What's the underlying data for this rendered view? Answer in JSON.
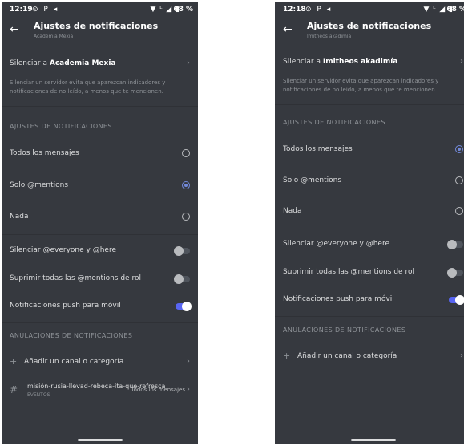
{
  "left": {
    "status": {
      "time": "12:19",
      "left_icons": "⊙ P ◂",
      "right_icons": "▼ ᴸ ◢ ▮",
      "battery": "68 %"
    },
    "header": {
      "title": "Ajustes de notificaciones",
      "subtitle": "Academia Mexia"
    },
    "mute_server": {
      "prefix": "Silenciar a ",
      "server": "Academia Mexia"
    },
    "mute_description": "Silenciar un servidor evita que aparezcan indicadores y notificaciones de no leído, a menos que te mencionen.",
    "notification_settings_title": "AJUSTES DE NOTIFICACIONES",
    "options": [
      {
        "label": "Todos los mensajes",
        "selected": false
      },
      {
        "label": "Solo @mentions",
        "selected": true
      },
      {
        "label": "Nada",
        "selected": false
      }
    ],
    "toggles": [
      {
        "label": "Silenciar @everyone y @here",
        "on": false
      },
      {
        "label": "Suprimir todas las @mentions de rol",
        "on": false
      },
      {
        "label": "Notificaciones push para móvil",
        "on": true
      }
    ],
    "overrides_title": "ANULACIONES DE NOTIFICACIONES",
    "add_channel": "Añadir un canal o categoría",
    "override_channel": {
      "name": "misión-rusia-llevad-rebeca-ita-que-refresca",
      "category": "EVENTOS",
      "value": "Todos los mensajes"
    }
  },
  "right": {
    "status": {
      "time": "12:18",
      "left_icons": "⊙ P ◂",
      "right_icons": "▼ ᴸ ◢ ▮",
      "battery": "68 %"
    },
    "header": {
      "title": "Ajustes de notificaciones",
      "subtitle": "Imitheos akadimía"
    },
    "mute_server": {
      "prefix": "Silenciar a ",
      "server": "Imitheos akadimía"
    },
    "mute_description": "Silenciar un servidor evita que aparezcan indicadores y notificaciones de no leído, a menos que te mencionen.",
    "notification_settings_title": "AJUSTES DE NOTIFICACIONES",
    "options": [
      {
        "label": "Todos los mensajes",
        "selected": true
      },
      {
        "label": "Solo @mentions",
        "selected": false
      },
      {
        "label": "Nada",
        "selected": false
      }
    ],
    "toggles": [
      {
        "label": "Silenciar @everyone y @here",
        "on": false
      },
      {
        "label": "Suprimir todas las @mentions de rol",
        "on": false
      },
      {
        "label": "Notificaciones push para móvil",
        "on": true
      }
    ],
    "overrides_title": "ANULACIONES DE NOTIFICACIONES",
    "add_channel": "Añadir un canal o categoría"
  }
}
